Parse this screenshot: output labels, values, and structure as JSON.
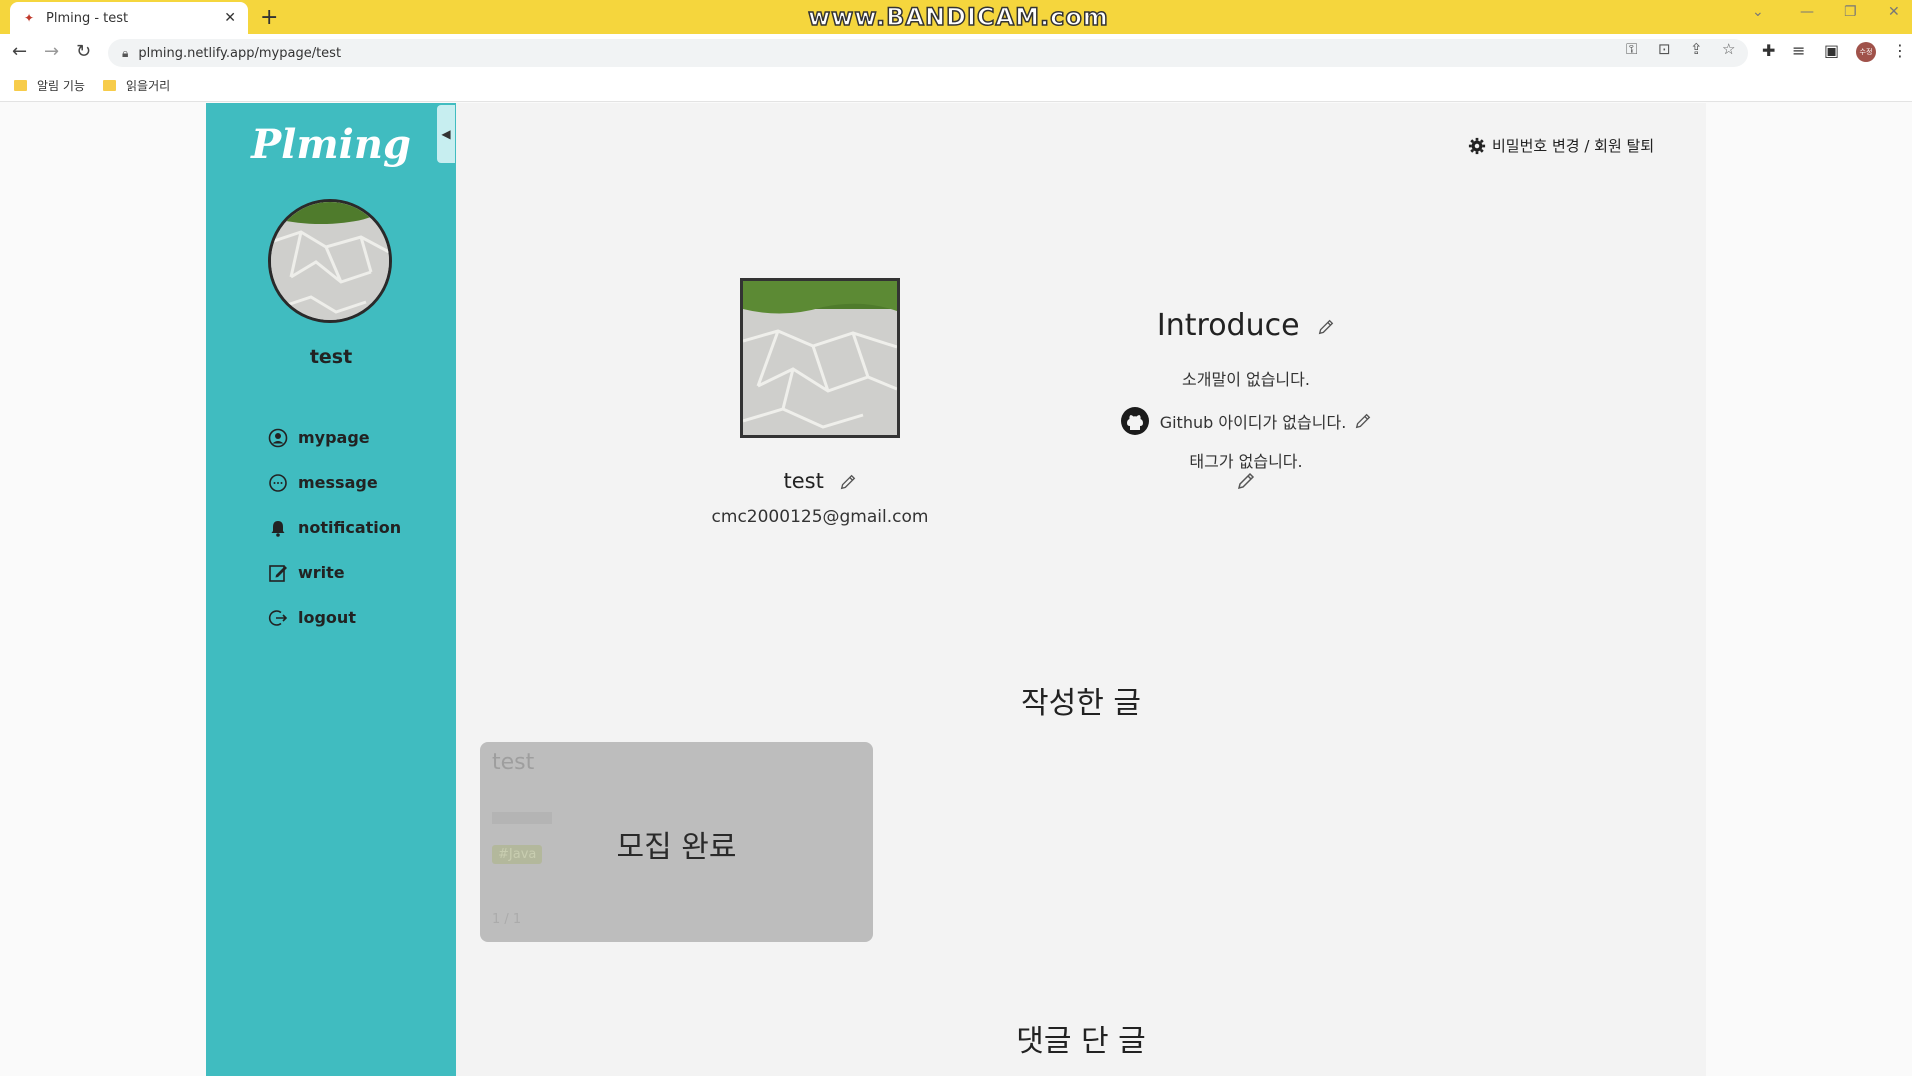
{
  "browser": {
    "tab_title": "Plming - test",
    "tab_favicon": "plming-favicon",
    "new_tab": "+",
    "watermark": "www.BANDICAM.com",
    "url": "plming.netlify.app/mypage/test",
    "bookmarks": [
      "알림 기능",
      "읽을거리"
    ],
    "profile_initials": "수정"
  },
  "sidebar": {
    "logo": "Plming",
    "user_name": "test",
    "collapse_icon": "◀",
    "menu": [
      {
        "label": "mypage",
        "icon": "user-circle-icon"
      },
      {
        "label": "message",
        "icon": "chat-bubble-icon"
      },
      {
        "label": "notification",
        "icon": "bell-icon"
      },
      {
        "label": "write",
        "icon": "edit-icon"
      },
      {
        "label": "logout",
        "icon": "logout-icon"
      }
    ],
    "color": "#40bcc0"
  },
  "header": {
    "settings_link": "비밀번호 변경 / 회원 탈퇴"
  },
  "profile": {
    "name": "test",
    "email": "cmc2000125@gmail.com"
  },
  "introduce": {
    "title": "Introduce",
    "text": "소개말이 없습니다.",
    "github": "Github 아이디가 없습니다.",
    "tags": "태그가 없습니다."
  },
  "sections": {
    "written_posts": "작성한 글",
    "commented_posts": "댓글 단 글"
  },
  "posts": [
    {
      "title": "test",
      "tag": "#Java",
      "date": "1 / 1",
      "status": "모집 완료"
    }
  ]
}
